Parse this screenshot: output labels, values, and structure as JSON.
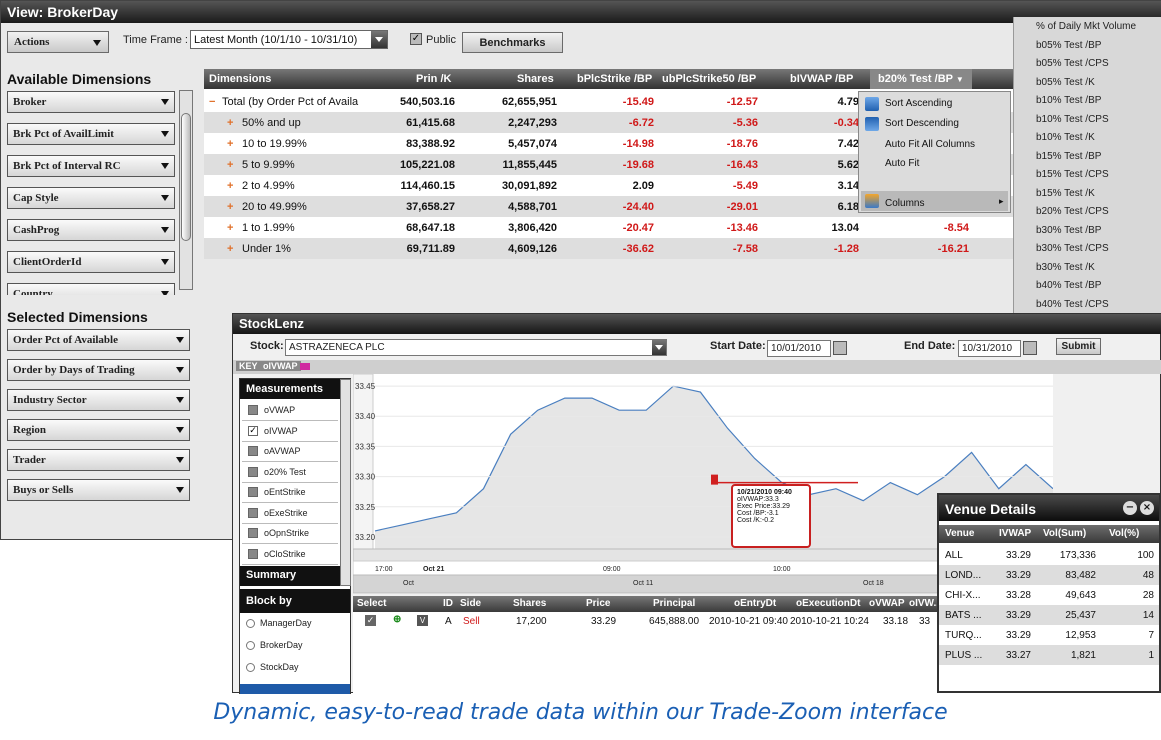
{
  "broker": {
    "title": "View: BrokerDay",
    "actions": "Actions",
    "timeframe_label": "Time Frame :",
    "timeframe_value": "Latest Month (10/1/10 - 10/31/10)",
    "public_label": "Public",
    "benchmarks": "Benchmarks",
    "available_title": "Available Dimensions",
    "available": [
      "Broker",
      "Brk Pct of AvailLimit",
      "Brk Pct of Interval RC",
      "Cap Style",
      "CashProg",
      "ClientOrderId",
      "Country"
    ],
    "selected_title": "Selected Dimensions",
    "selected": [
      "Order Pct of Available",
      "Order by Days of Trading",
      "Industry Sector",
      "Region",
      "Trader",
      "Buys or Sells"
    ]
  },
  "grid": {
    "headers": [
      "Dimensions",
      "Prin /K",
      "Shares",
      "bPlcStrike /BP",
      "ubPlcStrike50 /BP",
      "bIVWAP /BP",
      "b20% Test /BP"
    ],
    "rows": [
      {
        "dim": "Total (by Order Pct of Availa",
        "prin": "540,503.16",
        "shares": "62,655,951",
        "c1": "-15.49",
        "c2": "-12.57",
        "c3": "4.79",
        "c4": ""
      },
      {
        "dim": "50% and up",
        "prin": "61,415.68",
        "shares": "2,247,293",
        "c1": "-6.72",
        "c2": "-5.36",
        "c3": "-0.34",
        "c4": ""
      },
      {
        "dim": "10 to 19.99%",
        "prin": "83,388.92",
        "shares": "5,457,074",
        "c1": "-14.98",
        "c2": "-18.76",
        "c3": "7.42",
        "c4": ""
      },
      {
        "dim": "5 to 9.99%",
        "prin": "105,221.08",
        "shares": "11,855,445",
        "c1": "-19.68",
        "c2": "-16.43",
        "c3": "5.62",
        "c4": ""
      },
      {
        "dim": "2 to 4.99%",
        "prin": "114,460.15",
        "shares": "30,091,892",
        "c1": "2.09",
        "c2": "-5.49",
        "c3": "3.14",
        "c4": ""
      },
      {
        "dim": "20 to 49.99%",
        "prin": "37,658.27",
        "shares": "4,588,701",
        "c1": "-24.40",
        "c2": "-29.01",
        "c3": "6.18",
        "c4": ""
      },
      {
        "dim": "1 to 1.99%",
        "prin": "68,647.18",
        "shares": "3,806,420",
        "c1": "-20.47",
        "c2": "-13.46",
        "c3": "13.04",
        "c4": "-8.54"
      },
      {
        "dim": "Under 1%",
        "prin": "69,711.89",
        "shares": "4,609,126",
        "c1": "-36.62",
        "c2": "-7.58",
        "c3": "-1.28",
        "c4": "-16.21"
      }
    ]
  },
  "context_menu": [
    "Sort Ascending",
    "Sort Descending",
    "Auto Fit All Columns",
    "Auto Fit",
    "Columns"
  ],
  "metric_list": [
    "% of Daily Mkt Volume",
    "b05% Test /BP",
    "b05% Test /CPS",
    "b05% Test /K",
    "b10% Test /BP",
    "b10% Test /CPS",
    "b10% Test /K",
    "b15% Test /BP",
    "b15% Test /CPS",
    "b15% Test /K",
    "b20% Test /CPS",
    "b30% Test /BP",
    "b30% Test /CPS",
    "b30% Test /K",
    "b40% Test /BP",
    "b40% Test /CPS"
  ],
  "stocklenz": {
    "title": "StockLenz",
    "stock_label": "Stock:",
    "stock_value": "ASTRAZENECA PLC",
    "start_label": "Start Date:",
    "start_value": "10/01/2010",
    "end_label": "End Date:",
    "end_value": "10/31/2010",
    "submit": "Submit",
    "key_label": "KEY",
    "key_series": "oIVWAP",
    "measurements_title": "Measurements",
    "measurements": [
      {
        "label": "oVWAP",
        "checked": false
      },
      {
        "label": "oIVWAP",
        "checked": true
      },
      {
        "label": "oAVWAP",
        "checked": false
      },
      {
        "label": "o20% Test",
        "checked": false
      },
      {
        "label": "oEntStrike",
        "checked": false
      },
      {
        "label": "oExeStrike",
        "checked": false
      },
      {
        "label": "oOpnStrike",
        "checked": false
      },
      {
        "label": "oCloStrike",
        "checked": false
      }
    ],
    "summary": "Summary",
    "block_by": "Block by",
    "block_options": [
      "ManagerDay",
      "BrokerDay",
      "StockDay"
    ],
    "tooltip": [
      "10/21/2010 09:40",
      "oIVWAP:33.3",
      "Exec Price:33.29",
      "Cost /BP:-3.1",
      "Cost /K:-0.2"
    ],
    "trade_headers": [
      "Select",
      "ID",
      "Side",
      "Shares",
      "Price",
      "Principal",
      "oEntryDt",
      "oExecutionDt",
      "oVWAP",
      "oIVW..."
    ],
    "trade": {
      "id": "A",
      "side": "Sell",
      "shares": "17,200",
      "price": "33.29",
      "principal": "645,888.00",
      "entry": "2010-10-21 09:40",
      "exec": "2010-10-21 10:24",
      "vwap": "33.18",
      "ivw": "33"
    }
  },
  "chart_data": {
    "type": "area",
    "series": [
      {
        "name": "oIVWAP",
        "values": [
          33.21,
          33.22,
          33.23,
          33.24,
          33.28,
          33.37,
          33.41,
          33.43,
          33.43,
          33.41,
          33.41,
          33.45,
          33.44,
          33.38,
          33.33,
          33.29,
          33.27,
          33.28,
          33.26,
          33.29,
          33.27,
          33.3,
          33.34,
          33.28,
          33.32,
          33.28
        ]
      }
    ],
    "ylim": [
      33.18,
      33.47
    ],
    "yticks": [
      "33.45",
      "33.40",
      "33.35",
      "33.30",
      "33.25",
      "33.20"
    ],
    "xticks_top": [
      "17:00",
      "Oct 21",
      "09:00",
      "10:00"
    ],
    "xticks_bottom": [
      "Oct",
      "Oct 11",
      "Oct 18"
    ]
  },
  "venue": {
    "title": "Venue Details",
    "headers": [
      "Venue",
      "IVWAP",
      "Vol(Sum)",
      "Vol(%)"
    ],
    "rows": [
      {
        "venue": "ALL",
        "ivwap": "33.29",
        "vol": "173,336",
        "pct": "100"
      },
      {
        "venue": "LOND...",
        "ivwap": "33.29",
        "vol": "83,482",
        "pct": "48"
      },
      {
        "venue": "CHI-X...",
        "ivwap": "33.28",
        "vol": "49,643",
        "pct": "28"
      },
      {
        "venue": "BATS ...",
        "ivwap": "33.29",
        "vol": "25,437",
        "pct": "14"
      },
      {
        "venue": "TURQ...",
        "ivwap": "33.29",
        "vol": "12,953",
        "pct": "7"
      },
      {
        "venue": "PLUS ...",
        "ivwap": "33.27",
        "vol": "1,821",
        "pct": "1"
      }
    ]
  },
  "caption": "Dynamic, easy-to-read trade data within our Trade-Zoom interface",
  "colors": {
    "negative": "#d01818",
    "line": "#4a7fc0",
    "area": "#e6e6e6",
    "caption": "#1a5fb4"
  }
}
